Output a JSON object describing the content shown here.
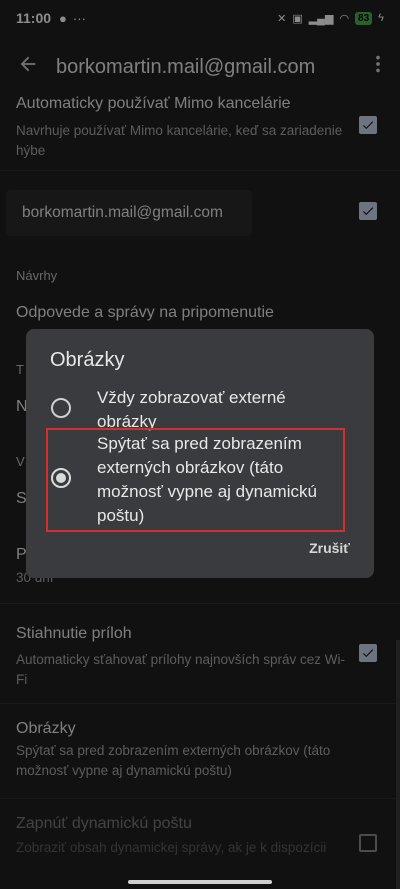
{
  "status_bar": {
    "time": "11:00",
    "battery": "83",
    "notification_icons": [
      "bulb-icon",
      "more-icon"
    ],
    "system_icons": [
      "mute-icon",
      "volte-icon",
      "signal-icon",
      "wifi-icon",
      "battery-icon",
      "charging-icon"
    ]
  },
  "app_bar": {
    "title": "borkomartin.mail@gmail.com",
    "back_icon": "arrow-back-icon",
    "menu_icon": "more-vert-icon"
  },
  "settings": {
    "auto_ooo": {
      "title": "Automaticky používať Mimo kancelárie",
      "subtitle": "Navrhuje používať Mimo kancelárie, keď sa zariadenie hýbe",
      "checked": true
    },
    "account": {
      "email": "borkomartin.mail@gmail.com",
      "checked": true
    },
    "nudges_section": "Návrhy",
    "nudges": {
      "title": "Odpovede a správy na pripomenutie"
    },
    "partial_letters": {
      "t1": "T",
      "n1": "N",
      "v1": "V",
      "s1": "S",
      "p1": "P",
      "days": "30 dní"
    },
    "attachments": {
      "title": "Stiahnutie príloh",
      "subtitle": "Automaticky sťahovať prílohy najnovších správ cez Wi-Fi",
      "checked": true
    },
    "images": {
      "title": "Obrázky",
      "subtitle": "Spýtať sa pred zobrazením externých obrázkov (táto možnosť vypne aj dynamickú poštu)"
    },
    "dynamic": {
      "title": "Zapnúť dynamickú poštu",
      "subtitle": "Zobraziť obsah dynamickej správy, ak je k dispozícii",
      "checked": false
    }
  },
  "dialog": {
    "title": "Obrázky",
    "options": [
      {
        "label": "Vždy zobrazovať externé obrázky",
        "selected": false
      },
      {
        "label": "Spýtať sa pred zobrazením externých obrázkov (táto možnosť vypne aj dynamickú poštu)",
        "selected": true
      }
    ],
    "cancel": "Zrušiť"
  },
  "colors": {
    "background": "#1f1f1f",
    "dialog": "#3a3b3e",
    "highlight": "#d32f2f",
    "checkbox": "#c6d3ea"
  }
}
